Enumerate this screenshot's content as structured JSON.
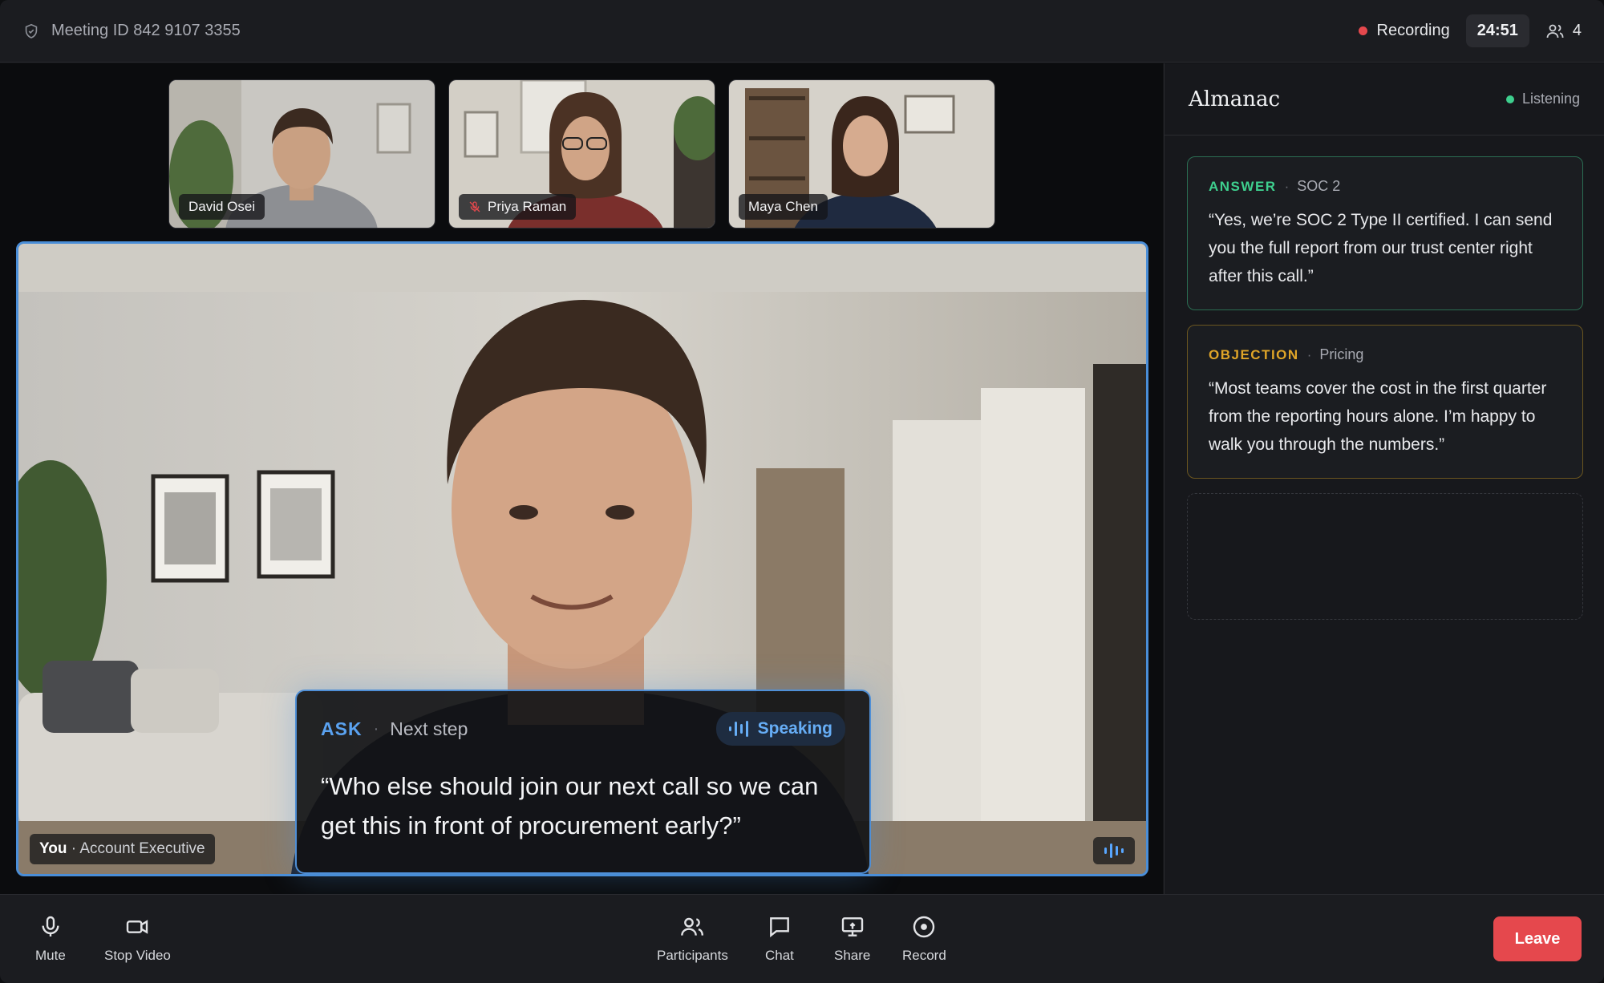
{
  "topbar": {
    "meeting_id": "Meeting ID 842 9107 3355",
    "recording_label": "Recording",
    "timer": "24:51",
    "participant_count": "4"
  },
  "thumbnails": [
    {
      "name": "David Osei",
      "muted": false
    },
    {
      "name": "Priya Raman",
      "muted": true
    },
    {
      "name": "Maya Chen",
      "muted": false
    }
  ],
  "main_video": {
    "you": "You",
    "role": "· Account Executive"
  },
  "prompt": {
    "type": "ASK",
    "separator": "·",
    "subtitle": "Next step",
    "status": "Speaking",
    "quote": "“Who else should join our next call so we can get this in front of procurement early?”"
  },
  "side_panel": {
    "title": "Almanac",
    "status": "Listening",
    "cards": [
      {
        "type": "ANSWER",
        "tag": "SOC 2",
        "quote": "“Yes, we’re SOC 2 Type II certified. I can send you the full report from our trust center right after this call.”"
      },
      {
        "type": "OBJECTION",
        "tag": "Pricing",
        "quote": "“Most teams cover the cost in the first quarter from the reporting hours alone. I’m happy to walk you through the numbers.”"
      }
    ]
  },
  "controls": {
    "mute": "Mute",
    "stop_video": "Stop Video",
    "participants": "Participants",
    "chat": "Chat",
    "share": "Share",
    "record": "Record",
    "leave": "Leave"
  },
  "colors": {
    "accent": "#4a8ed8",
    "answer": "#3ecf8e",
    "objection": "#e0a528",
    "leave": "#e5484d",
    "recording": "#e5484d"
  }
}
